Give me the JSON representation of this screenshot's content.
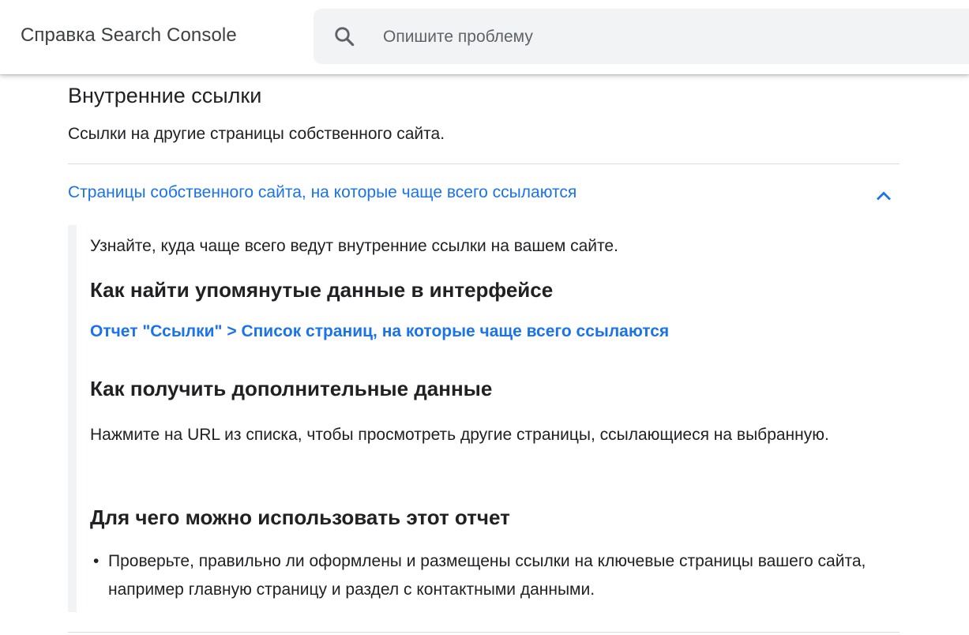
{
  "header": {
    "app_title": "Справка Search Console",
    "search": {
      "placeholder": "Опишите проблему",
      "icon": "search-icon"
    }
  },
  "section": {
    "title": "Внутренние ссылки",
    "description": "Ссылки на другие страницы собственного сайта."
  },
  "accordion": {
    "title": "Страницы собственного сайта, на которые чаще всего ссылаются",
    "expanded": true,
    "icon": "chevron-up-icon",
    "intro": "Узнайте, куда чаще всего ведут внутренние ссылки на вашем сайте.",
    "find_heading": "Как найти упомянутые данные в интерфейсе",
    "find_link": "Отчет \"Ссылки\" > Список страниц, на которые чаще всего ссылаются",
    "more_heading": "Как получить дополнительные данные",
    "more_text": "Нажмите на URL из списка, чтобы просмотреть другие страницы, ссылающиеся на выбранную.",
    "use_heading": "Для чего можно использовать этот отчет",
    "use_items": [
      "Проверьте, правильно ли оформлены и размещены ссылки на ключевые страницы вашего сайта, например главную страницу и раздел с контактными данными."
    ],
    "bullet": "•"
  },
  "colors": {
    "link": "#1a73e8",
    "text": "#202124",
    "search_bg": "#f1f3f4",
    "panel_border": "#f1f3f4",
    "divider": "#dadce0"
  }
}
